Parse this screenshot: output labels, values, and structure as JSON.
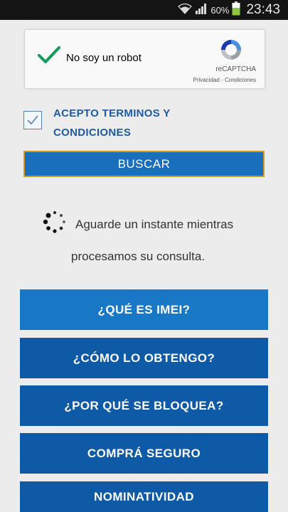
{
  "status_bar": {
    "battery_percent": "60%",
    "time": "23:43",
    "icons": [
      "wifi-icon",
      "signal-icon",
      "battery-icon"
    ]
  },
  "captcha": {
    "label": "No soy un robot",
    "brand": "reCAPTCHA",
    "links": "Privacidad - Condiciones",
    "checked": true
  },
  "terms": {
    "label": "ACEPTO TERMINOS Y CONDICIONES",
    "checked": true
  },
  "search_button": {
    "label": "BUSCAR"
  },
  "loading": {
    "line1": "Aguarde un instante mientras",
    "line2": "procesamos su consulta."
  },
  "info_buttons": [
    {
      "label": "¿QUÉ ES IMEI?"
    },
    {
      "label": "¿CÓMO LO OBTENGO?"
    },
    {
      "label": "¿POR QUÉ SE BLOQUEA?"
    },
    {
      "label": "COMPRÁ SEGURO"
    },
    {
      "label": "NOMINATIVIDAD"
    }
  ],
  "colors": {
    "primary_blue": "#0e5aa6",
    "active_blue": "#1878c6",
    "check_green": "#0f9d58",
    "focus_border": "#d29a1a"
  }
}
